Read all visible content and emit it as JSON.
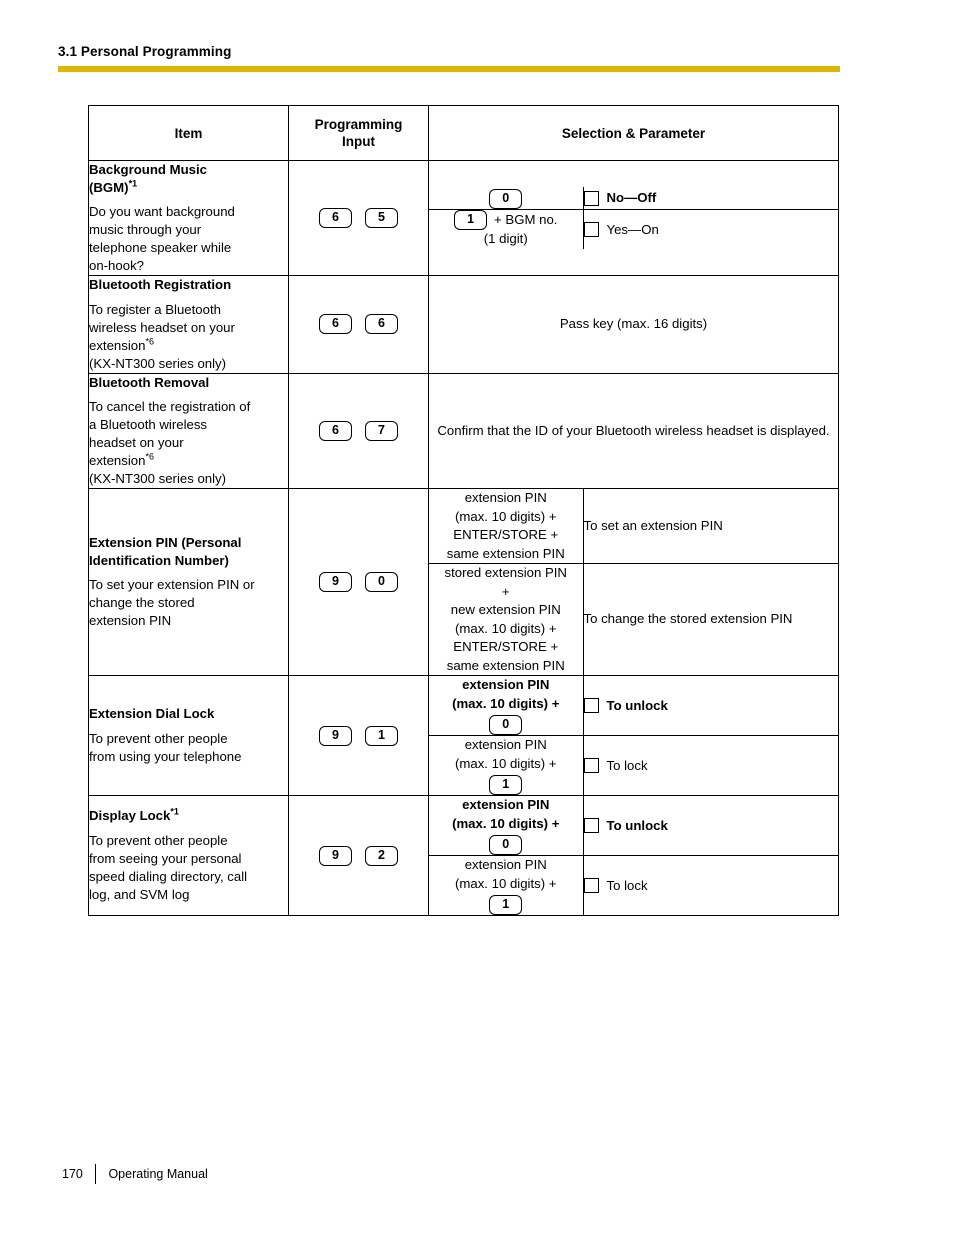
{
  "header": {
    "section_title": "3.1 Personal Programming",
    "rule_color": "#dfb508"
  },
  "table": {
    "columns": {
      "item": "Item",
      "programming_input_line1": "Programming",
      "programming_input_line2": "Input",
      "selection_parameter": "Selection & Parameter"
    },
    "rows": [
      {
        "item": {
          "title": "Background Music",
          "title_line2": "(BGM)",
          "title_sup": "*1",
          "desc_lines": [
            "Do you want background",
            "music through your",
            "telephone speaker while",
            "on-hook?"
          ]
        },
        "keys": [
          "6",
          "5"
        ],
        "sub_rows": [
          {
            "selection_lines": [],
            "selection_key": "0",
            "selection_bold": false,
            "parameter_label": "No—Off",
            "parameter_bold": true,
            "has_checkbox": true
          },
          {
            "selection_inline_key": "1",
            "selection_inline_text": "+ BGM no.",
            "selection_lines": [
              "(1 digit)"
            ],
            "selection_bold": false,
            "parameter_label": "Yes—On",
            "parameter_bold": false,
            "has_checkbox": true
          }
        ]
      },
      {
        "item": {
          "title": "Bluetooth Registration",
          "desc_lines": [
            "To register a Bluetooth",
            "wireless headset on your",
            "extension*6",
            "(KX-NT300 series only)"
          ]
        },
        "keys": [
          "6",
          "6"
        ],
        "merged_text": "Pass key (max. 16 digits)"
      },
      {
        "item": {
          "title": "Bluetooth Removal",
          "desc_lines": [
            "To cancel the registration of",
            "a Bluetooth wireless",
            "headset on your",
            "extension*6",
            "(KX-NT300 series only)"
          ]
        },
        "keys": [
          "6",
          "7"
        ],
        "merged_text": "Confirm that the ID of your Bluetooth wireless headset is displayed."
      },
      {
        "item": {
          "title": "Extension PIN (Personal",
          "title_line2": "Identification Number)",
          "desc_lines": [
            "To set your extension PIN or",
            "change the stored",
            "extension PIN"
          ]
        },
        "keys": [
          "9",
          "0"
        ],
        "sub_rows": [
          {
            "selection_lines": [
              "extension PIN",
              "(max. 10 digits) +",
              "ENTER/STORE +",
              "same extension PIN"
            ],
            "selection_bold": false,
            "parameter_label": "To set an extension PIN",
            "parameter_bold": false,
            "has_checkbox": false
          },
          {
            "selection_lines": [
              "stored extension PIN",
              "+",
              "new extension PIN",
              "(max. 10 digits) +",
              "ENTER/STORE +",
              "same extension PIN"
            ],
            "selection_bold": false,
            "parameter_label": "To change the stored extension PIN",
            "parameter_bold": false,
            "has_checkbox": false
          }
        ]
      },
      {
        "item": {
          "title": "Extension Dial Lock",
          "desc_lines": [
            "To prevent other people",
            "from using your telephone"
          ]
        },
        "keys": [
          "9",
          "1"
        ],
        "sub_rows": [
          {
            "selection_lines": [
              "extension PIN",
              "(max. 10 digits) +"
            ],
            "selection_key": "0",
            "selection_bold": true,
            "parameter_label": "To unlock",
            "parameter_bold": true,
            "has_checkbox": true
          },
          {
            "selection_lines": [
              "extension PIN",
              "(max. 10 digits) +"
            ],
            "selection_key": "1",
            "selection_bold": false,
            "parameter_label": "To lock",
            "parameter_bold": false,
            "has_checkbox": true
          }
        ]
      },
      {
        "item": {
          "title": "Display Lock",
          "title_sup": "*1",
          "desc_lines": [
            "To prevent other people",
            "from seeing your personal",
            "speed dialing directory, call",
            "log, and SVM log"
          ]
        },
        "keys": [
          "9",
          "2"
        ],
        "sub_rows": [
          {
            "selection_lines": [
              "extension PIN",
              "(max. 10 digits) +"
            ],
            "selection_key": "0",
            "selection_bold": true,
            "parameter_label": "To unlock",
            "parameter_bold": true,
            "has_checkbox": true
          },
          {
            "selection_lines": [
              "extension PIN",
              "(max. 10 digits) +"
            ],
            "selection_key": "1",
            "selection_bold": false,
            "parameter_label": "To lock",
            "parameter_bold": false,
            "has_checkbox": true
          }
        ]
      }
    ]
  },
  "footer": {
    "page_number": "170",
    "document_title": "Operating Manual"
  }
}
